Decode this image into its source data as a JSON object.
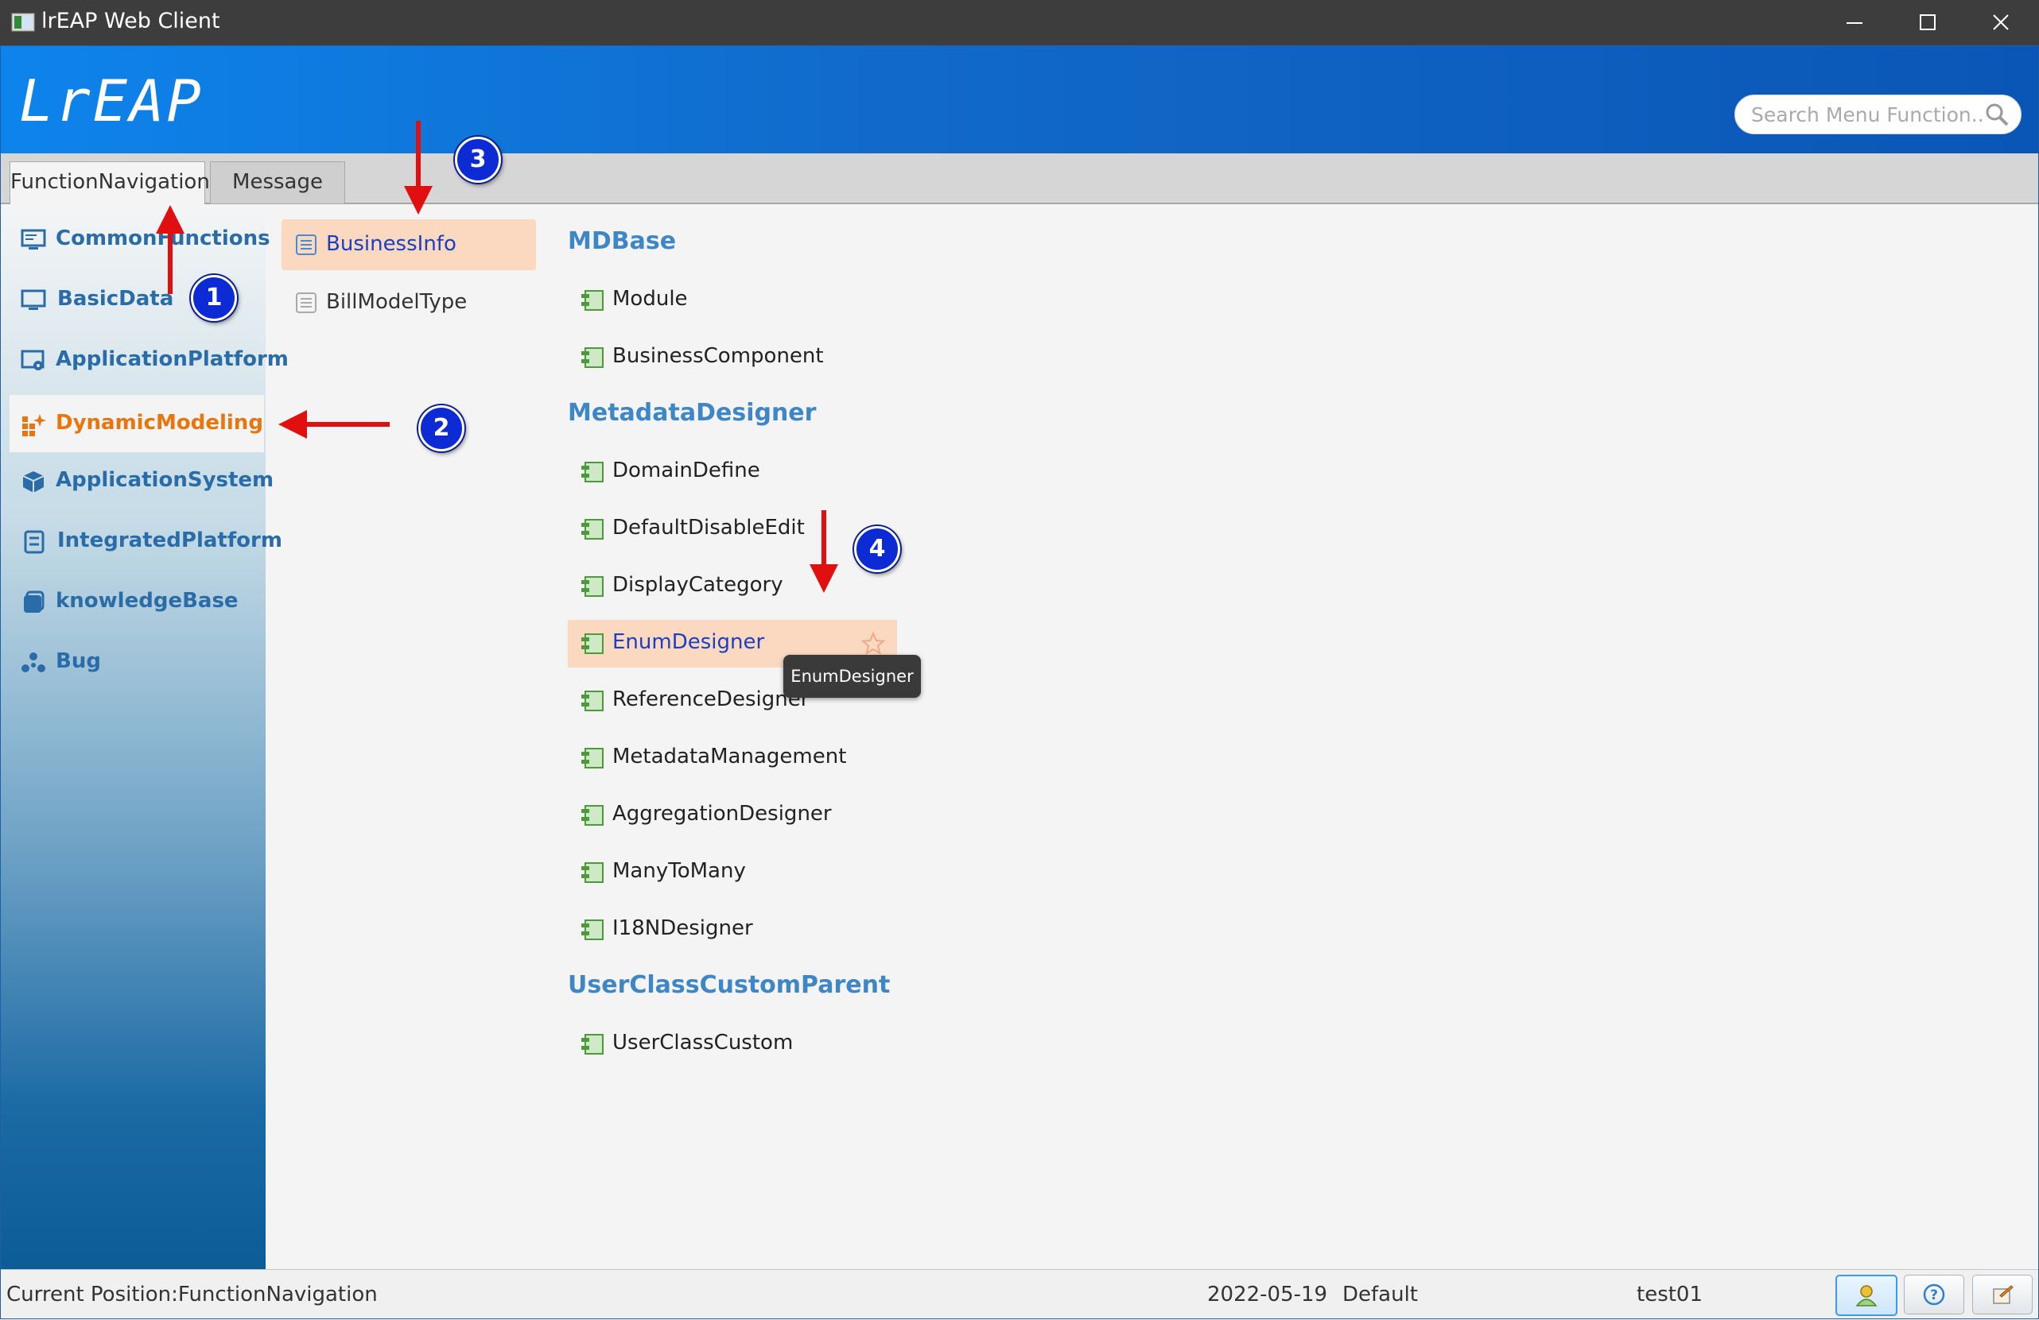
{
  "window": {
    "title": "lrEAP Web Client",
    "controls": [
      "minimize",
      "maximize",
      "close"
    ]
  },
  "banner": {
    "logo": "LrEAP",
    "search_placeholder": "Search Menu Function..."
  },
  "tabs": [
    {
      "label": "FunctionNavigation",
      "active": true
    },
    {
      "label": "Message",
      "active": false
    }
  ],
  "sidebar": {
    "items": [
      {
        "label": "CommonFunctions",
        "icon": "monitor-icon"
      },
      {
        "label": "BasicData",
        "icon": "monitor-icon"
      },
      {
        "label": "ApplicationPlatform",
        "icon": "platform-gear-icon"
      },
      {
        "label": "DynamicModeling",
        "icon": "grid-sparkle-icon",
        "selected": true
      },
      {
        "label": "ApplicationSystem",
        "icon": "cube-icon"
      },
      {
        "label": "IntegratedPlatform",
        "icon": "server-icon"
      },
      {
        "label": "knowledgeBase",
        "icon": "book-icon"
      },
      {
        "label": "Bug",
        "icon": "bug-icon"
      }
    ]
  },
  "submenu": {
    "items": [
      {
        "label": "BusinessInfo",
        "selected": true
      },
      {
        "label": "BillModelType",
        "selected": false
      }
    ]
  },
  "content": {
    "groups": [
      {
        "title": "MDBase",
        "items": [
          "Module",
          "BusinessComponent"
        ]
      },
      {
        "title": "MetadataDesigner",
        "items": [
          "DomainDefine",
          "DefaultDisableEdit",
          "DisplayCategory",
          "EnumDesigner",
          "ReferenceDesigner",
          "MetadataManagement",
          "AggregationDesigner",
          "ManyToMany",
          "I18NDesigner"
        ]
      },
      {
        "title": "UserClassCustomParent",
        "items": [
          "UserClassCustom"
        ]
      }
    ],
    "selected_item": "EnumDesigner"
  },
  "tooltip": "EnumDesigner",
  "annotations": [
    "1",
    "2",
    "3",
    "4"
  ],
  "statusbar": {
    "position": "Current Position:FunctionNavigation",
    "date": "2022-05-19",
    "mode": "Default",
    "user": "test01",
    "buttons": [
      "user-icon",
      "help-icon",
      "notes-icon"
    ]
  },
  "colors": {
    "banner": "#0d6fd8",
    "sidebar_label": "#2a6ca8",
    "sidebar_selected": "#e8760e",
    "selection_bg": "#fbd9c0",
    "group_heading": "#3e86c6",
    "annotation_arrow": "#e01010",
    "annotation_badge": "#0c2bd4"
  }
}
